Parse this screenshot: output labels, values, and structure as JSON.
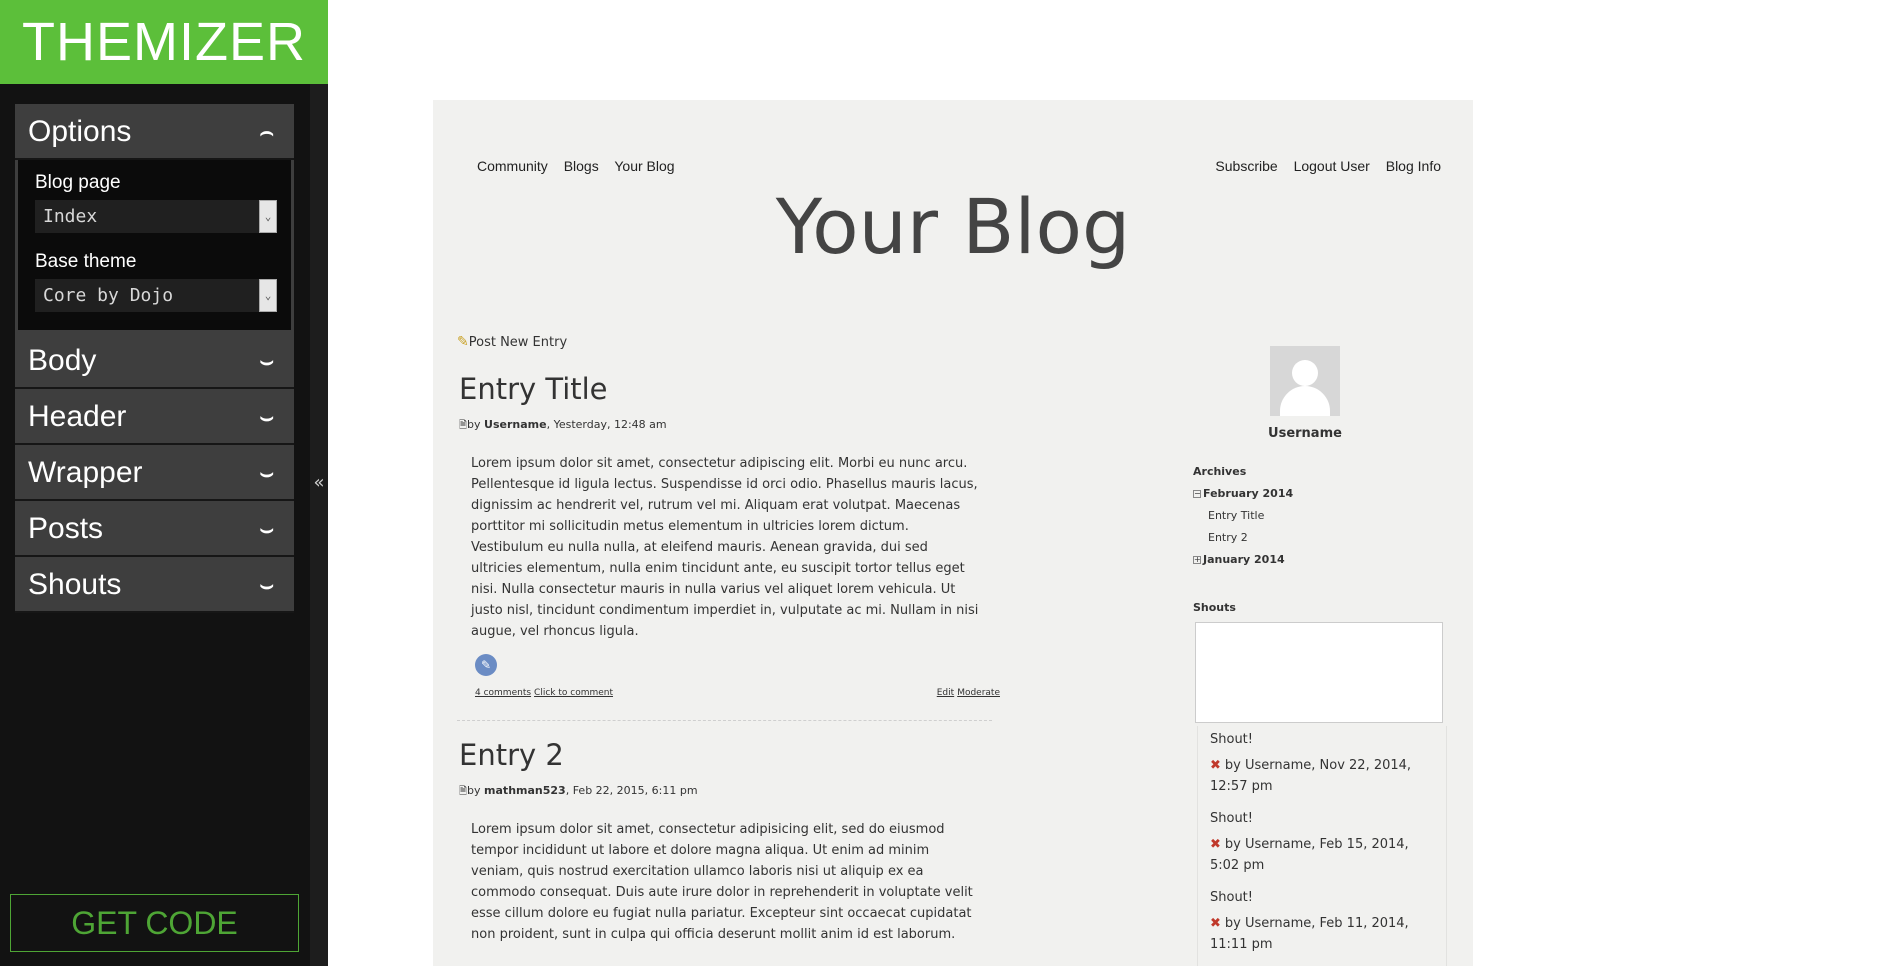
{
  "app": {
    "title": "THEMIZER",
    "get_code": "GET CODE",
    "collapse_icon": "«"
  },
  "options": {
    "label": "Options",
    "blog_page": {
      "label": "Blog page",
      "value": "Index"
    },
    "base_theme": {
      "label": "Base theme",
      "value": "Core by Dojo"
    }
  },
  "sections": [
    {
      "label": "Body"
    },
    {
      "label": "Header"
    },
    {
      "label": "Wrapper"
    },
    {
      "label": "Posts"
    },
    {
      "label": "Shouts"
    }
  ],
  "preview": {
    "nav_left": [
      "Community",
      "Blogs",
      "Your Blog"
    ],
    "nav_right": [
      "Subscribe",
      "Logout User",
      "Blog Info"
    ],
    "blog_title": "Your Blog",
    "post_new": "Post New Entry",
    "entries": [
      {
        "title": "Entry Title",
        "author": "Username",
        "date": ", Yesterday, 12:48 am",
        "body": "Lorem ipsum dolor sit amet, consectetur adipiscing elit. Morbi eu nunc arcu. Pellentesque id ligula lectus. Suspendisse id orci odio. Phasellus mauris lacus, dignissim ac hendrerit vel, rutrum vel mi. Aliquam erat volutpat. Maecenas porttitor mi sollicitudin metus elementum in ultricies lorem dictum. Vestibulum eu nulla nulla, at eleifend mauris. Aenean gravida, dui sed ultricies elementum, nulla enim tincidunt ante, eu suscipit tortor tellus eget nisi. Nulla consectetur mauris in nulla varius vel aliquet lorem vehicula. Ut justo nisl, tincidunt condimentum imperdiet in, vulputate ac mi. Nullam in nisi augue, vel rhoncus ligula.",
        "comments": "4 comments",
        "click_to_comment": "Click to comment",
        "edit": "Edit",
        "moderate": "Moderate"
      },
      {
        "title": "Entry 2",
        "author": "mathman523",
        "date": ", Feb 22, 2015, 6:11 pm",
        "body": "Lorem ipsum dolor sit amet, consectetur adipisicing elit, sed do eiusmod tempor incididunt ut labore et dolore magna aliqua. Ut enim ad minim veniam, quis nostrud exercitation ullamco laboris nisi ut aliquip ex ea commodo consequat. Duis aute irure dolor in reprehenderit in voluptate velit esse cillum dolore eu fugiat nulla pariatur. Excepteur sint occaecat cupidatat non proident, sunt in culpa qui officia deserunt mollit anim id est laborum."
      }
    ],
    "sidebar": {
      "username": "Username",
      "archives_label": "Archives",
      "archives": [
        {
          "month": "February 2014",
          "entries": [
            "Entry Title",
            "Entry 2"
          ]
        },
        {
          "month": "January 2014"
        }
      ],
      "shouts_label": "Shouts",
      "shouts": [
        {
          "title": "Shout!",
          "meta": "by Username, Nov 22, 2014, 12:57 pm"
        },
        {
          "title": "Shout!",
          "meta": "by Username, Feb 15, 2014, 5:02 pm"
        },
        {
          "title": "Shout!",
          "meta": "by Username, Feb 11, 2014, 11:11 pm"
        }
      ]
    }
  },
  "colors": {
    "brand": "#5cbf3a",
    "panel": "#121212",
    "accordion": "#3e3e3e",
    "preview_bg": "#f1f1ef"
  }
}
